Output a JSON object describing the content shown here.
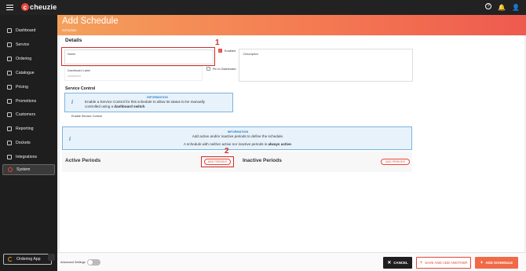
{
  "topbar": {
    "brand": "cheuzie",
    "brand_mark": "c",
    "icons": {
      "help": "?",
      "notifications": "🔔",
      "account": "👤"
    }
  },
  "sidebar": {
    "items": [
      {
        "label": "Dashboard"
      },
      {
        "label": "Service"
      },
      {
        "label": "Ordering"
      },
      {
        "label": "Catalogue"
      },
      {
        "label": "Pricing"
      },
      {
        "label": "Promotions"
      },
      {
        "label": "Customers"
      },
      {
        "label": "Reporting"
      },
      {
        "label": "Dockets"
      },
      {
        "label": "Integrations"
      },
      {
        "label": "System"
      }
    ],
    "ordering_app": "Ordering App"
  },
  "header": {
    "title": "Add Schedule",
    "breadcrumb": "Schedule"
  },
  "details": {
    "title": "Details",
    "name_label": "Name",
    "enabled_label": "Enabled",
    "description_label": "Description",
    "dashboard_label": "Dashboard Label",
    "dashboard_placeholder": "undefined",
    "pin_label": "Pin to Dashboard"
  },
  "service_control": {
    "title": "Service Control",
    "info_header": "INFORMATION",
    "info_line1": "Enable a Service Control for this schedule to allow its status to be manually",
    "info_line2_pre": "controlled using a ",
    "info_line2_bold": "dashboard switch",
    "info_line2_post": ".",
    "enable_label": "Enable Service Control"
  },
  "periods_info": {
    "header": "INFORMATION",
    "line1": "Add active and/or inactive periods to define the schedule.",
    "line2_pre": "A schedule with neither active nor inactive periods is ",
    "line2_bold": "always active",
    "line2_post": "."
  },
  "active_periods": {
    "title": "Active Periods",
    "add_label": "ADD PERIODS"
  },
  "inactive_periods": {
    "title": "Inactive Periods",
    "add_label": "ADD PERIODS"
  },
  "annotations": {
    "one": "1",
    "two": "2"
  },
  "footer": {
    "advanced_label": "Advanced Settings",
    "cancel": "CANCEL",
    "save_add": "SAVE AND ADD ANOTHER",
    "add_schedule": "ADD SCHEDULE"
  },
  "colors": {
    "accent": "#e8463a",
    "info": "#2e84c8",
    "annotation": "#d12c2c"
  }
}
